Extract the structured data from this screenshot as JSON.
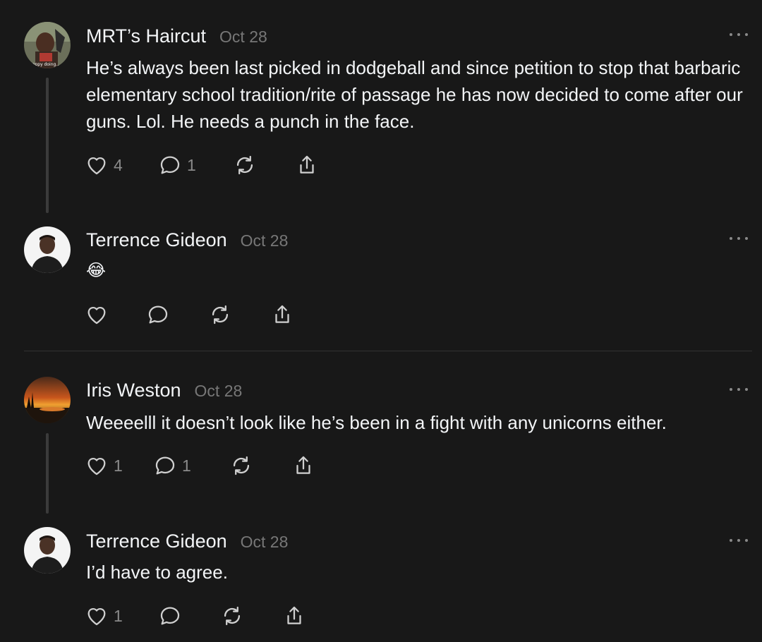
{
  "posts": [
    {
      "username": "MRT’s Haircut",
      "date": "Oct 28",
      "text": "He’s always been last picked in dodgeball and since petition to stop that barbaric elementary school tradition/rite of passage he has now decided to come after our guns. Lol. He needs a punch in the face.",
      "avatar_caption": "happy doing...",
      "likes": "4",
      "replies": "1"
    },
    {
      "username": "Terrence Gideon",
      "date": "Oct 28",
      "text": "😂",
      "likes": "",
      "replies": ""
    },
    {
      "username": "Iris Weston",
      "date": "Oct 28",
      "text": "Weeeelll it doesn’t look like he’s been in a fight with any unicorns either.",
      "likes": "1",
      "replies": "1"
    },
    {
      "username": "Terrence Gideon",
      "date": "Oct 28",
      "text": "I’d have to agree.",
      "likes": "1",
      "replies": ""
    }
  ],
  "icons": {
    "like": "heart-icon",
    "reply": "comment-icon",
    "repost": "repost-icon",
    "share": "share-icon",
    "more": "more-options-icon"
  },
  "colors": {
    "background": "#181818",
    "primary_text": "#f3f5f7",
    "secondary_text": "#777777",
    "icon": "#d0d0d0",
    "thread_line": "#3b3b3b"
  }
}
